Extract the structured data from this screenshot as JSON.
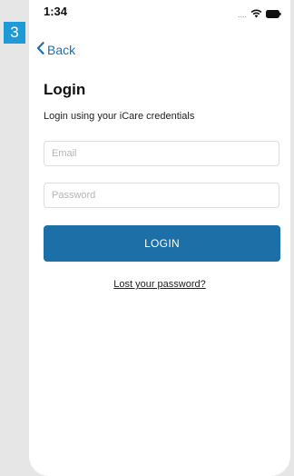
{
  "step_badge": "3",
  "status_bar": {
    "time": "1:34",
    "signal_dots": "....",
    "icons": [
      "wifi-icon",
      "battery-icon"
    ]
  },
  "nav": {
    "back_label": "Back",
    "back_icon": "chevron-left-icon"
  },
  "login": {
    "title": "Login",
    "subtitle": "Login using your iCare credentials",
    "email_placeholder": "Email",
    "email_value": "",
    "password_placeholder": "Password",
    "password_value": "",
    "button_label": "LOGIN",
    "lost_password_label": "Lost your password?"
  },
  "colors": {
    "accent": "#1d6fa8",
    "link": "#1b6fb0",
    "badge": "#1e9ad6",
    "background": "#e6e6e6"
  }
}
